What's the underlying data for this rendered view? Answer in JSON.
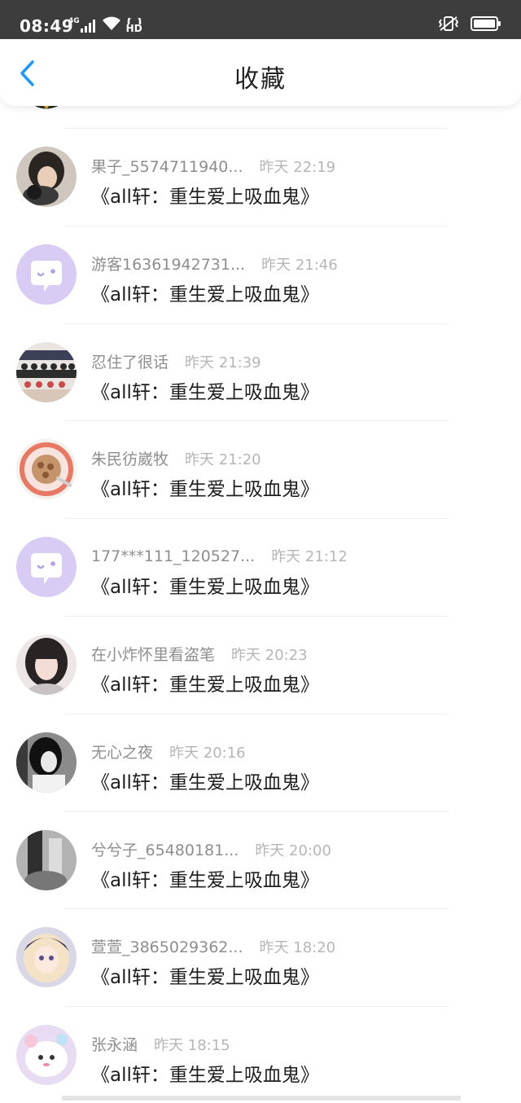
{
  "status_bar": {
    "time": "08:49",
    "network": "4G",
    "hd": "HD",
    "icons": [
      "signal-icon",
      "wifi-icon",
      "hd-voice-icon",
      "vibrate-icon",
      "battery-icon"
    ]
  },
  "nav": {
    "back_icon": "chevron-left-icon",
    "title": "收藏",
    "accent": "#2196f3"
  },
  "favorites": [
    {
      "user": "果子_5574711940...",
      "time": "昨天 22:19",
      "title": "《all轩：重生爱上吸血鬼》",
      "avatar": "photo"
    },
    {
      "user": "游客16361942731...",
      "time": "昨天 21:46",
      "title": "《all轩：重生爱上吸血鬼》",
      "avatar": "default"
    },
    {
      "user": "忍住了很话",
      "time": "昨天 21:39",
      "title": "《all轩：重生爱上吸血鬼》",
      "avatar": "photo"
    },
    {
      "user": "朱民彷崴牧",
      "time": "昨天 21:20",
      "title": "《all轩：重生爱上吸血鬼》",
      "avatar": "photo"
    },
    {
      "user": "177***111_120527...",
      "time": "昨天 21:12",
      "title": "《all轩：重生爱上吸血鬼》",
      "avatar": "default"
    },
    {
      "user": "在小炸怀里看盗笔",
      "time": "昨天 20:23",
      "title": "《all轩：重生爱上吸血鬼》",
      "avatar": "photo"
    },
    {
      "user": "无心之夜",
      "time": "昨天 20:16",
      "title": "《all轩：重生爱上吸血鬼》",
      "avatar": "photo"
    },
    {
      "user": "兮兮子_65480181...",
      "time": "昨天 20:00",
      "title": "《all轩：重生爱上吸血鬼》",
      "avatar": "photo"
    },
    {
      "user": "萱萱_3865029362...",
      "time": "昨天 18:20",
      "title": "《all轩：重生爱上吸血鬼》",
      "avatar": "photo"
    },
    {
      "user": "张永涵",
      "time": "昨天 18:15",
      "title": "《all轩：重生爱上吸血鬼》",
      "avatar": "photo"
    }
  ],
  "colors": {
    "default_avatar": "#d8cbf4",
    "status_bar": "#3d3d3d",
    "username": "#8e8e8e",
    "time": "#b6b6b6"
  }
}
